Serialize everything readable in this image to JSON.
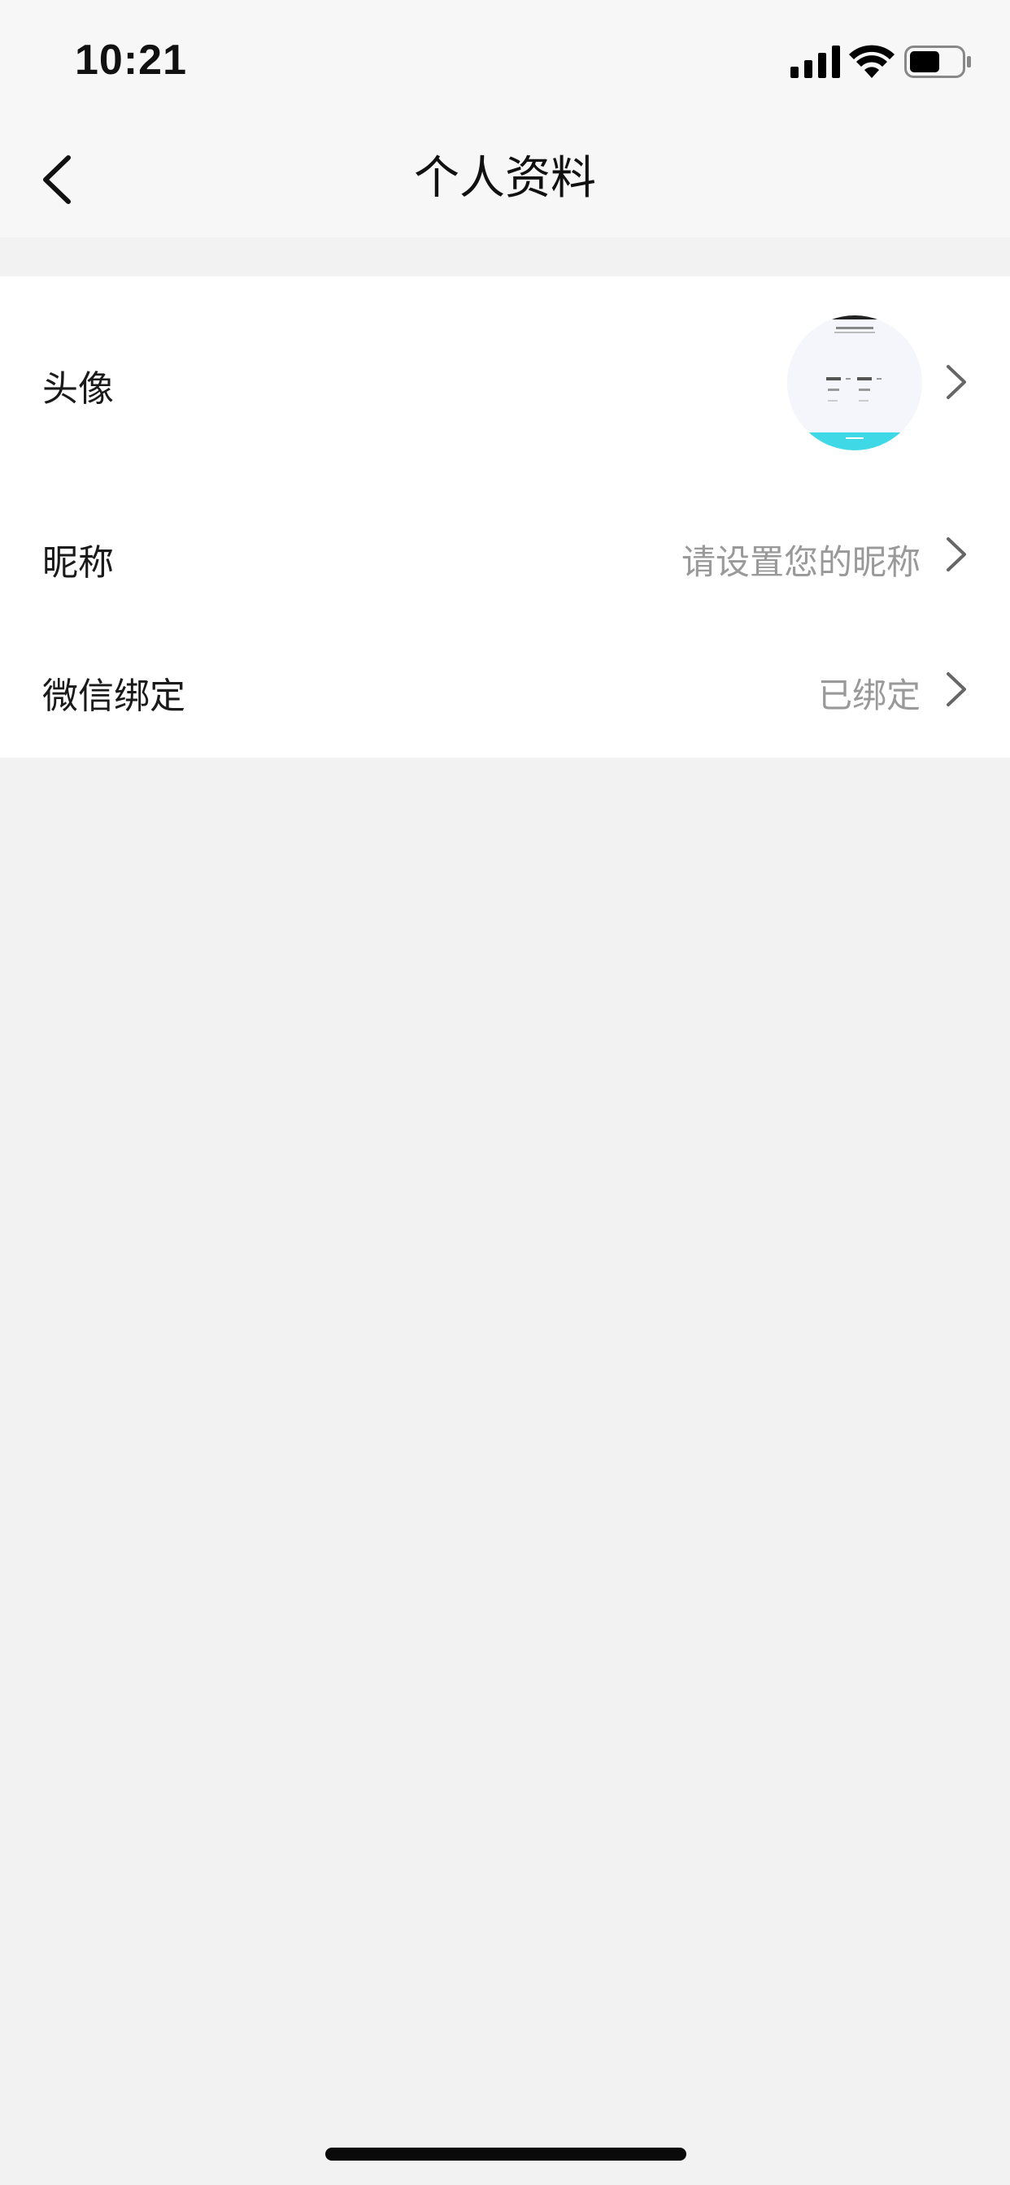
{
  "status_bar": {
    "time": "10:21",
    "icons": [
      "signal-icon",
      "wifi-icon",
      "battery-icon"
    ]
  },
  "nav": {
    "title": "个人资料",
    "back_icon": "chevron-left-icon"
  },
  "profile_rows": [
    {
      "label": "头像",
      "value": "",
      "icon": "avatar-image"
    },
    {
      "label": "昵称",
      "value": "请设置您的昵称"
    },
    {
      "label": "微信绑定",
      "value": "已绑定"
    }
  ],
  "colors": {
    "background": "#f2f2f2",
    "header_bg": "#f7f7f7",
    "card_bg": "#ffffff",
    "label": "#1a1a1a",
    "value": "#999999",
    "avatar_accent": "#3ed8e6"
  }
}
